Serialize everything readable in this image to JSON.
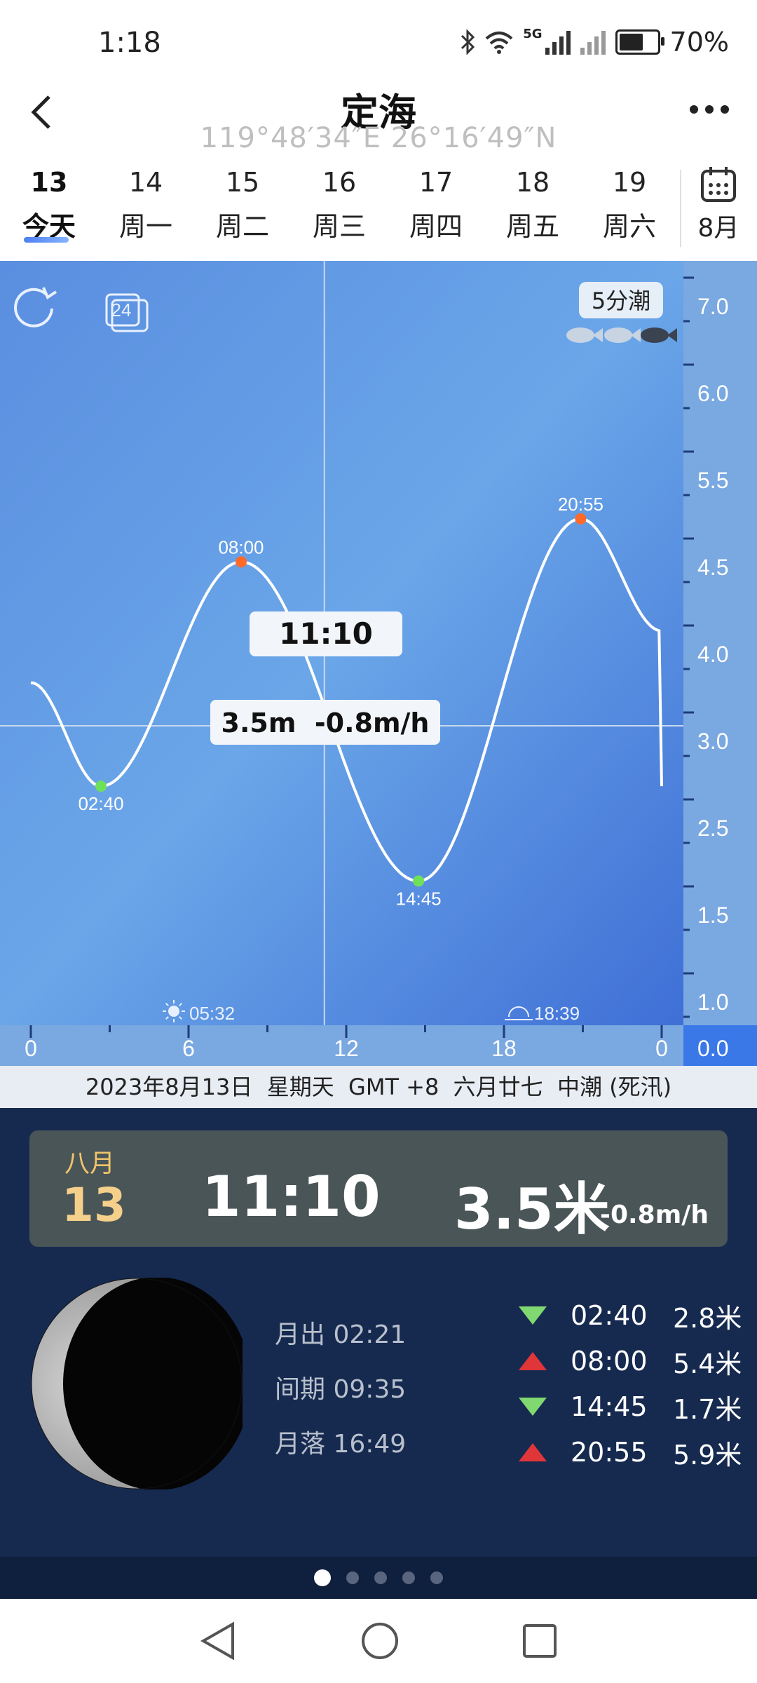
{
  "status": {
    "time": "1:18",
    "battery": "70%",
    "battery_level": 0.7,
    "net_label": "5G"
  },
  "header": {
    "title": "定海",
    "coords": "119°48′34″E   26°16′49″N"
  },
  "days": [
    {
      "num": "13",
      "week": "今天",
      "active": true
    },
    {
      "num": "14",
      "week": "周一"
    },
    {
      "num": "15",
      "week": "周二"
    },
    {
      "num": "16",
      "week": "周三"
    },
    {
      "num": "17",
      "week": "周四"
    },
    {
      "num": "18",
      "week": "周五"
    },
    {
      "num": "19",
      "week": "周六"
    }
  ],
  "calendar": {
    "month": "8月"
  },
  "chart": {
    "badge": "5分潮",
    "refresh_icon": "refresh-icon",
    "toggle_24": "24",
    "cursor_time": "11:10",
    "cursor_value": "3.5m  -0.8m/h",
    "sunrise": "05:32",
    "sunset": "18:39"
  },
  "chart_data": {
    "type": "line",
    "title": "",
    "xlabel": "",
    "ylabel": "",
    "x_ticks": [
      "0",
      "6",
      "12",
      "18",
      "0"
    ],
    "y_ticks": [
      "7.0",
      "6.0",
      "5.5",
      "4.5",
      "4.0",
      "3.0",
      "2.5",
      "1.5",
      "1.0",
      "0.0"
    ],
    "xlim": [
      0,
      24
    ],
    "extremes": [
      {
        "time": "02:40",
        "x": 2.667,
        "height": 2.8,
        "kind": "low"
      },
      {
        "time": "08:00",
        "x": 8.0,
        "height": 5.4,
        "kind": "high"
      },
      {
        "time": "14:45",
        "x": 14.75,
        "height": 1.7,
        "kind": "low"
      },
      {
        "time": "20:55",
        "x": 20.917,
        "height": 5.9,
        "kind": "high"
      }
    ],
    "start": {
      "x": 0,
      "height": 4.0
    },
    "end": {
      "x": 24,
      "height": 4.6
    },
    "cursor": {
      "x": 11.1667,
      "height": 3.5
    },
    "colors": {
      "high": "#ff6a2a",
      "low": "#6fe05a",
      "curve": "#ffffff"
    }
  },
  "info_strip": "2023年8月13日  星期天  GMT +8  六月廿七  中潮 (死汛)",
  "summary": {
    "month": "八月",
    "day": "13",
    "time": "11:10",
    "height": "3.5米",
    "rate": "-0.8m/h"
  },
  "moon": {
    "rise": "月出 02:21",
    "period": "间期 09:35",
    "set": "月落 16:49"
  },
  "tides": [
    {
      "dir": "down",
      "time": "02:40",
      "height": "2.8米"
    },
    {
      "dir": "up",
      "time": "08:00",
      "height": "5.4米"
    },
    {
      "dir": "down",
      "time": "14:45",
      "height": "1.7米"
    },
    {
      "dir": "up",
      "time": "20:55",
      "height": "5.9米"
    }
  ],
  "pager": {
    "count": 5,
    "active": 0
  }
}
